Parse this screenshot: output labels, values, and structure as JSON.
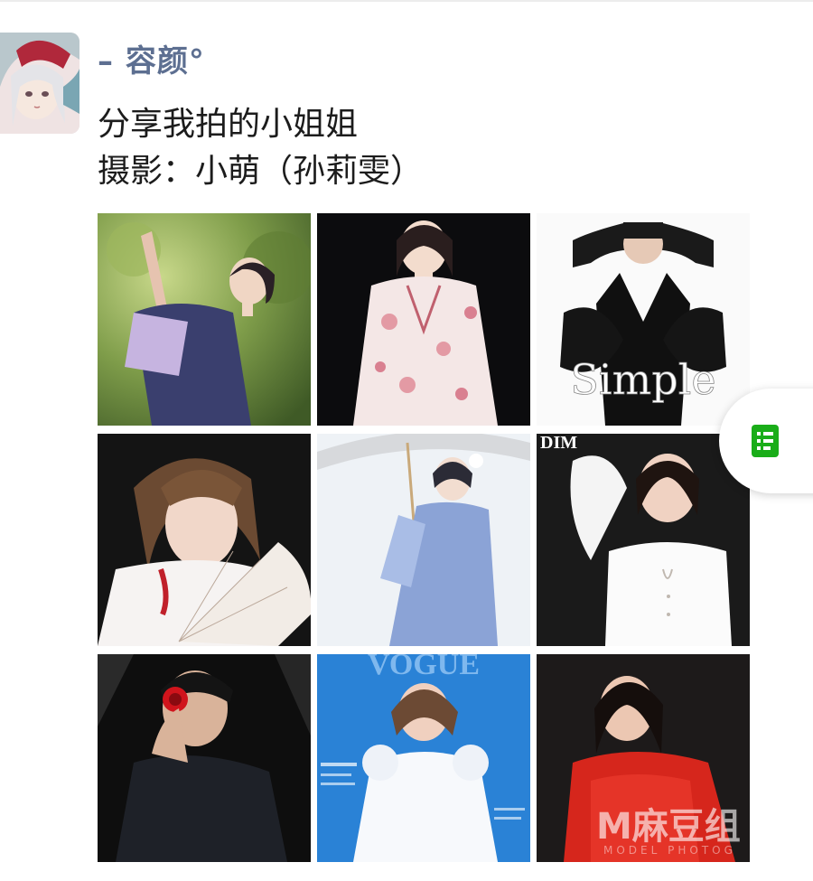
{
  "post": {
    "username": "– 容颜°",
    "text_line1": "分享我拍的小姐姐",
    "text_line2": "摄影：小萌（孙莉雯）"
  },
  "photos": [
    {
      "caption": ""
    },
    {
      "caption": ""
    },
    {
      "caption": "Simple"
    },
    {
      "caption": ""
    },
    {
      "caption": ""
    },
    {
      "caption": "DIM"
    },
    {
      "caption": ""
    },
    {
      "caption": "VOGUE"
    },
    {
      "caption": ""
    }
  ],
  "floating_button": {
    "icon": "document-icon",
    "color": "#1aad19"
  },
  "watermark": {
    "main": "M麻豆组",
    "sub": "MODEL PHOTOG"
  },
  "colors": {
    "username": "#5d6f91",
    "accent": "#1aad19"
  }
}
